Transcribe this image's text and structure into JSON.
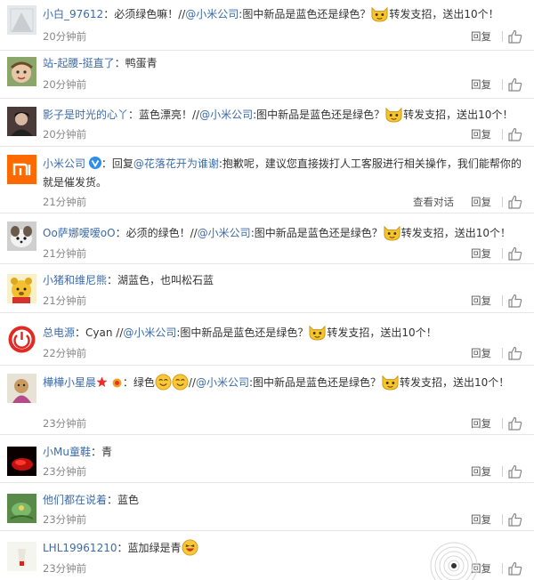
{
  "comments": [
    {
      "user": "小白_97612",
      "pre": "：必须绿色嘛！//",
      "mention": "@小米公司",
      "post": ":图中新品是蓝色还是绿色？",
      "tail": "转发支招，送出10个！",
      "time": "20分钟前",
      "reply": "回复"
    },
    {
      "user": "站-起腰-挺直了",
      "pre": "：鸭蛋青",
      "time": "20分钟前",
      "reply": "回复"
    },
    {
      "user": "影子是时光的心丫",
      "pre": "：蓝色漂亮！//",
      "mention": "@小米公司",
      "post": ":图中新品是蓝色还是绿色？",
      "tail": "转发支招，送出10个！",
      "time": "20分钟前",
      "reply": "回复"
    },
    {
      "user": "小米公司",
      "pre": "：回复",
      "mention": "@花落花开为谁谢",
      "post": ":抱歉呢，建议您直接拨打人工客服进行相关操作，我们能帮你的就是催发货。",
      "time": "21分钟前",
      "view": "查看对话",
      "reply": "回复"
    },
    {
      "user": "Oo萨娜嗳嗳oO",
      "pre": "：必须的绿色！//",
      "mention": "@小米公司",
      "post": ":图中新品是蓝色还是绿色？",
      "tail": "转发支招，送出10个！",
      "time": "21分钟前",
      "reply": "回复"
    },
    {
      "user": "小猪和维尼熊",
      "pre": "：湖蓝色，也叫松石蓝",
      "time": "21分钟前",
      "reply": "回复"
    },
    {
      "user": "总电源",
      "pre": "：Cyan //",
      "mention": "@小米公司",
      "post": ":图中新品是蓝色还是绿色？",
      "tail": "转发支招，送出10个！",
      "time": "22分钟前",
      "reply": "回复"
    },
    {
      "user": "樺樺小星晨",
      "pre": "：绿色",
      "mid": "//",
      "mention": "@小米公司",
      "post": ":图中新品是蓝色还是绿色？",
      "tail": "转发支招，送出10个！",
      "time": "23分钟前",
      "reply": "回复"
    },
    {
      "user": "小Mu童鞋",
      "pre": "：青",
      "time": "23分钟前",
      "reply": "回复"
    },
    {
      "user": "他们都在说着",
      "pre": "：蓝色",
      "time": "23分钟前",
      "reply": "回复"
    },
    {
      "user": "LHL19961210",
      "pre": "：蓝加绿是青",
      "time": "23分钟前",
      "reply": "回复"
    }
  ],
  "icons": {
    "like": "thumbs-up-icon",
    "verified": "verified-v-icon",
    "cat": "cat-emoji-icon",
    "smile": "smile-emoji-icon",
    "laugh": "laugh-emoji-icon"
  },
  "colors": {
    "link": "#3d6ba8",
    "text": "#333333",
    "meta": "#888888",
    "divider": "#e6e6e6",
    "mi_orange": "#ff6a00"
  }
}
